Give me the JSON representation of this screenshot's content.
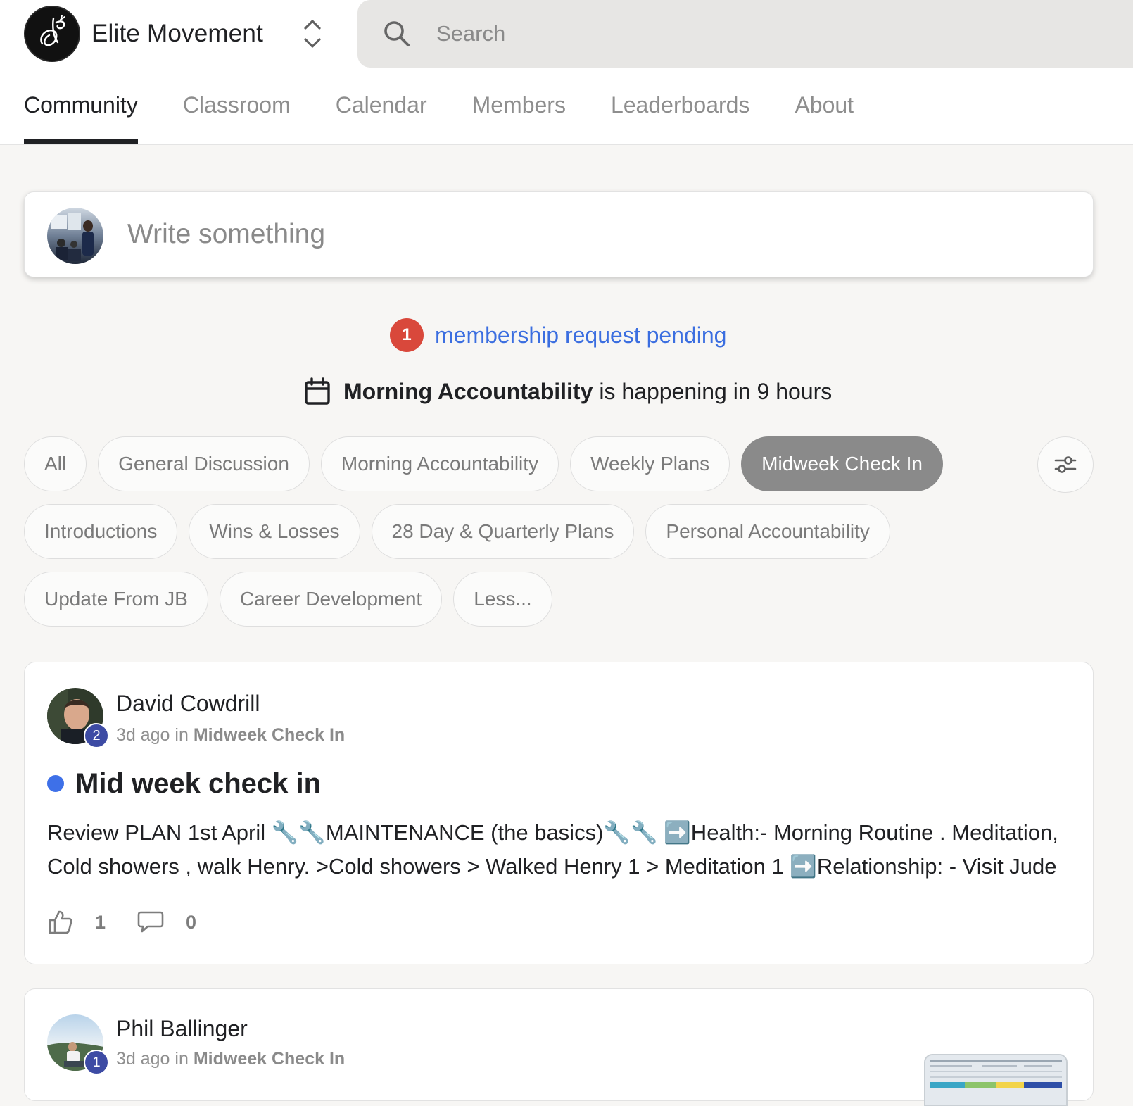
{
  "header": {
    "group_name": "Elite Movement",
    "search_placeholder": "Search"
  },
  "tabs": [
    {
      "label": "Community",
      "active": true
    },
    {
      "label": "Classroom",
      "active": false
    },
    {
      "label": "Calendar",
      "active": false
    },
    {
      "label": "Members",
      "active": false
    },
    {
      "label": "Leaderboards",
      "active": false
    },
    {
      "label": "About",
      "active": false
    }
  ],
  "composer": {
    "placeholder": "Write something"
  },
  "membership": {
    "count": "1",
    "text": "membership request pending"
  },
  "event": {
    "name": "Morning Accountability",
    "text": "is happening in 9 hours"
  },
  "categories": {
    "row1": [
      "All",
      "General Discussion",
      "Morning Accountability",
      "Weekly Plans",
      "Midweek Check In"
    ],
    "row2": [
      "Introductions",
      "Wins & Losses",
      "28 Day & Quarterly Plans",
      "Personal Accountability"
    ],
    "row3": [
      "Update From JB",
      "Career Development",
      "Less..."
    ],
    "selected": "Midweek Check In"
  },
  "posts": [
    {
      "author": "David Cowdrill",
      "level": "2",
      "time": "3d ago in",
      "category": "Midweek Check In",
      "title": "Mid week check in",
      "body": "Review PLAN 1st April 🔧🔧MAINTENANCE (the basics)🔧🔧 ➡️Health:- Morning Routine . Meditation, Cold showers , walk Henry. >Cold showers > Walked Henry 1 > Meditation 1 ➡️Relationship: - Visit Jude",
      "likes": "1",
      "comments": "0"
    },
    {
      "author": "Phil Ballinger",
      "level": "1",
      "time": "3d ago in",
      "category": "Midweek Check In"
    }
  ],
  "colors": {
    "accent_link": "#3b6ee0",
    "badge_red": "#d9483b",
    "level_badge": "#3d4ba4",
    "unread_dot": "#3e70e8",
    "selected_chip": "#8a8a8a"
  },
  "icons": [
    "logo-icon",
    "switcher-icon",
    "search-icon",
    "calendar-icon",
    "filter-icon",
    "like-icon",
    "comment-icon"
  ]
}
